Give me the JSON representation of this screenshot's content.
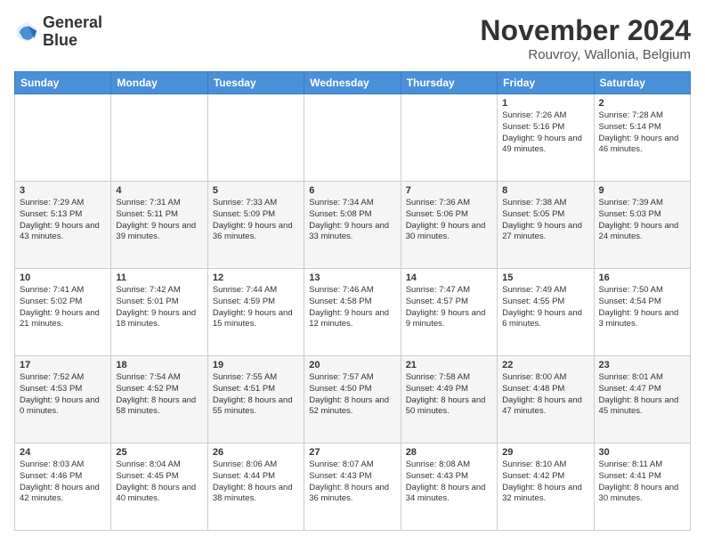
{
  "logo": {
    "line1": "General",
    "line2": "Blue"
  },
  "title": "November 2024",
  "location": "Rouvroy, Wallonia, Belgium",
  "days_of_week": [
    "Sunday",
    "Monday",
    "Tuesday",
    "Wednesday",
    "Thursday",
    "Friday",
    "Saturday"
  ],
  "weeks": [
    [
      {
        "day": "",
        "sunrise": "",
        "sunset": "",
        "daylight": ""
      },
      {
        "day": "",
        "sunrise": "",
        "sunset": "",
        "daylight": ""
      },
      {
        "day": "",
        "sunrise": "",
        "sunset": "",
        "daylight": ""
      },
      {
        "day": "",
        "sunrise": "",
        "sunset": "",
        "daylight": ""
      },
      {
        "day": "",
        "sunrise": "",
        "sunset": "",
        "daylight": ""
      },
      {
        "day": "1",
        "sunrise": "Sunrise: 7:26 AM",
        "sunset": "Sunset: 5:16 PM",
        "daylight": "Daylight: 9 hours and 49 minutes."
      },
      {
        "day": "2",
        "sunrise": "Sunrise: 7:28 AM",
        "sunset": "Sunset: 5:14 PM",
        "daylight": "Daylight: 9 hours and 46 minutes."
      }
    ],
    [
      {
        "day": "3",
        "sunrise": "Sunrise: 7:29 AM",
        "sunset": "Sunset: 5:13 PM",
        "daylight": "Daylight: 9 hours and 43 minutes."
      },
      {
        "day": "4",
        "sunrise": "Sunrise: 7:31 AM",
        "sunset": "Sunset: 5:11 PM",
        "daylight": "Daylight: 9 hours and 39 minutes."
      },
      {
        "day": "5",
        "sunrise": "Sunrise: 7:33 AM",
        "sunset": "Sunset: 5:09 PM",
        "daylight": "Daylight: 9 hours and 36 minutes."
      },
      {
        "day": "6",
        "sunrise": "Sunrise: 7:34 AM",
        "sunset": "Sunset: 5:08 PM",
        "daylight": "Daylight: 9 hours and 33 minutes."
      },
      {
        "day": "7",
        "sunrise": "Sunrise: 7:36 AM",
        "sunset": "Sunset: 5:06 PM",
        "daylight": "Daylight: 9 hours and 30 minutes."
      },
      {
        "day": "8",
        "sunrise": "Sunrise: 7:38 AM",
        "sunset": "Sunset: 5:05 PM",
        "daylight": "Daylight: 9 hours and 27 minutes."
      },
      {
        "day": "9",
        "sunrise": "Sunrise: 7:39 AM",
        "sunset": "Sunset: 5:03 PM",
        "daylight": "Daylight: 9 hours and 24 minutes."
      }
    ],
    [
      {
        "day": "10",
        "sunrise": "Sunrise: 7:41 AM",
        "sunset": "Sunset: 5:02 PM",
        "daylight": "Daylight: 9 hours and 21 minutes."
      },
      {
        "day": "11",
        "sunrise": "Sunrise: 7:42 AM",
        "sunset": "Sunset: 5:01 PM",
        "daylight": "Daylight: 9 hours and 18 minutes."
      },
      {
        "day": "12",
        "sunrise": "Sunrise: 7:44 AM",
        "sunset": "Sunset: 4:59 PM",
        "daylight": "Daylight: 9 hours and 15 minutes."
      },
      {
        "day": "13",
        "sunrise": "Sunrise: 7:46 AM",
        "sunset": "Sunset: 4:58 PM",
        "daylight": "Daylight: 9 hours and 12 minutes."
      },
      {
        "day": "14",
        "sunrise": "Sunrise: 7:47 AM",
        "sunset": "Sunset: 4:57 PM",
        "daylight": "Daylight: 9 hours and 9 minutes."
      },
      {
        "day": "15",
        "sunrise": "Sunrise: 7:49 AM",
        "sunset": "Sunset: 4:55 PM",
        "daylight": "Daylight: 9 hours and 6 minutes."
      },
      {
        "day": "16",
        "sunrise": "Sunrise: 7:50 AM",
        "sunset": "Sunset: 4:54 PM",
        "daylight": "Daylight: 9 hours and 3 minutes."
      }
    ],
    [
      {
        "day": "17",
        "sunrise": "Sunrise: 7:52 AM",
        "sunset": "Sunset: 4:53 PM",
        "daylight": "Daylight: 9 hours and 0 minutes."
      },
      {
        "day": "18",
        "sunrise": "Sunrise: 7:54 AM",
        "sunset": "Sunset: 4:52 PM",
        "daylight": "Daylight: 8 hours and 58 minutes."
      },
      {
        "day": "19",
        "sunrise": "Sunrise: 7:55 AM",
        "sunset": "Sunset: 4:51 PM",
        "daylight": "Daylight: 8 hours and 55 minutes."
      },
      {
        "day": "20",
        "sunrise": "Sunrise: 7:57 AM",
        "sunset": "Sunset: 4:50 PM",
        "daylight": "Daylight: 8 hours and 52 minutes."
      },
      {
        "day": "21",
        "sunrise": "Sunrise: 7:58 AM",
        "sunset": "Sunset: 4:49 PM",
        "daylight": "Daylight: 8 hours and 50 minutes."
      },
      {
        "day": "22",
        "sunrise": "Sunrise: 8:00 AM",
        "sunset": "Sunset: 4:48 PM",
        "daylight": "Daylight: 8 hours and 47 minutes."
      },
      {
        "day": "23",
        "sunrise": "Sunrise: 8:01 AM",
        "sunset": "Sunset: 4:47 PM",
        "daylight": "Daylight: 8 hours and 45 minutes."
      }
    ],
    [
      {
        "day": "24",
        "sunrise": "Sunrise: 8:03 AM",
        "sunset": "Sunset: 4:46 PM",
        "daylight": "Daylight: 8 hours and 42 minutes."
      },
      {
        "day": "25",
        "sunrise": "Sunrise: 8:04 AM",
        "sunset": "Sunset: 4:45 PM",
        "daylight": "Daylight: 8 hours and 40 minutes."
      },
      {
        "day": "26",
        "sunrise": "Sunrise: 8:06 AM",
        "sunset": "Sunset: 4:44 PM",
        "daylight": "Daylight: 8 hours and 38 minutes."
      },
      {
        "day": "27",
        "sunrise": "Sunrise: 8:07 AM",
        "sunset": "Sunset: 4:43 PM",
        "daylight": "Daylight: 8 hours and 36 minutes."
      },
      {
        "day": "28",
        "sunrise": "Sunrise: 8:08 AM",
        "sunset": "Sunset: 4:43 PM",
        "daylight": "Daylight: 8 hours and 34 minutes."
      },
      {
        "day": "29",
        "sunrise": "Sunrise: 8:10 AM",
        "sunset": "Sunset: 4:42 PM",
        "daylight": "Daylight: 8 hours and 32 minutes."
      },
      {
        "day": "30",
        "sunrise": "Sunrise: 8:11 AM",
        "sunset": "Sunset: 4:41 PM",
        "daylight": "Daylight: 8 hours and 30 minutes."
      }
    ]
  ]
}
